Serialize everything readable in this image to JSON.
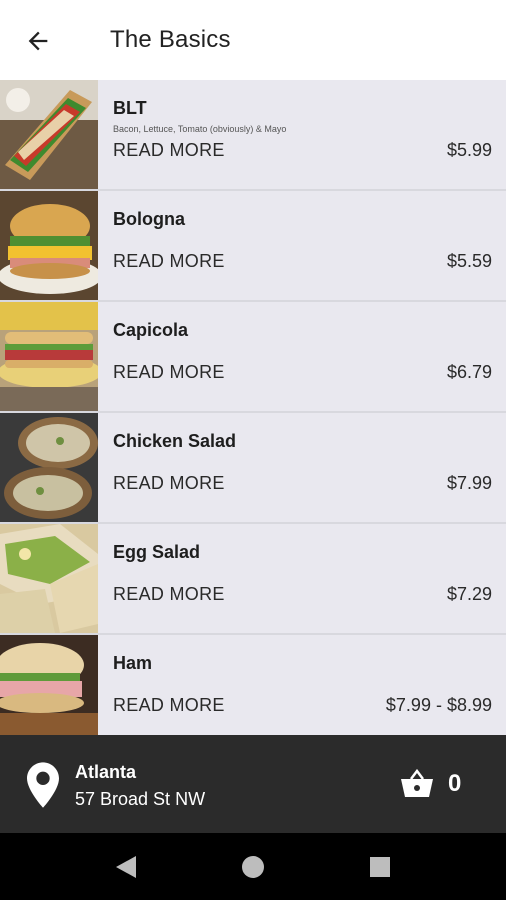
{
  "header": {
    "title": "The Basics",
    "back_icon": "arrow-left-icon"
  },
  "menu": {
    "items": [
      {
        "name": "BLT",
        "description": "Bacon, Lettuce, Tomato (obviously) & Mayo",
        "read_more": "READ MORE",
        "price": "$5.99"
      },
      {
        "name": "Bologna",
        "description": "",
        "read_more": "READ MORE",
        "price": "$5.59"
      },
      {
        "name": "Capicola",
        "description": "",
        "read_more": "READ MORE",
        "price": "$6.79"
      },
      {
        "name": "Chicken Salad",
        "description": "",
        "read_more": "READ MORE",
        "price": "$7.99"
      },
      {
        "name": "Egg Salad",
        "description": "",
        "read_more": "READ MORE",
        "price": "$7.29"
      },
      {
        "name": "Ham",
        "description": "",
        "read_more": "READ MORE",
        "price": "$7.99 - $8.99"
      }
    ]
  },
  "location": {
    "city": "Atlanta",
    "address": "57 Broad St NW",
    "pin_icon": "location-pin-icon"
  },
  "cart": {
    "count": "0",
    "icon": "basket-icon"
  },
  "navigation": {
    "back_icon": "triangle-back-icon",
    "home_icon": "circle-home-icon",
    "recents_icon": "square-recents-icon"
  },
  "colors": {
    "bottom_bar": "#2b2b2b",
    "list_background": "#e9e8ef",
    "nav_bar": "#000000"
  }
}
